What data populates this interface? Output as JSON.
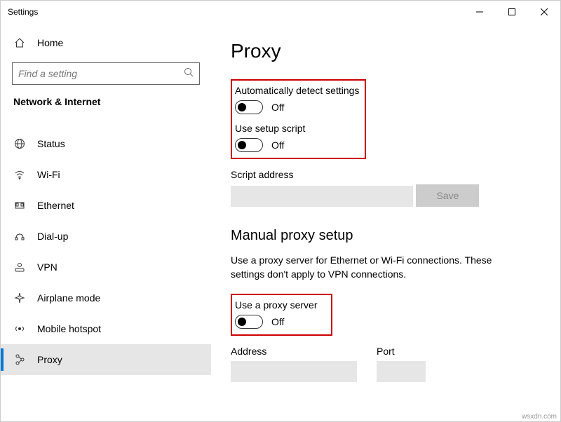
{
  "titlebar": {
    "title": "Settings"
  },
  "sidebar": {
    "home": "Home",
    "search_placeholder": "Find a setting",
    "section": "Network & Internet",
    "items": [
      {
        "label": "Status"
      },
      {
        "label": "Wi-Fi"
      },
      {
        "label": "Ethernet"
      },
      {
        "label": "Dial-up"
      },
      {
        "label": "VPN"
      },
      {
        "label": "Airplane mode"
      },
      {
        "label": "Mobile hotspot"
      },
      {
        "label": "Proxy"
      }
    ]
  },
  "main": {
    "title": "Proxy",
    "auto_detect": {
      "label": "Automatically detect settings",
      "state": "Off"
    },
    "setup_script": {
      "label": "Use setup script",
      "state": "Off"
    },
    "script_address_label": "Script address",
    "save": "Save",
    "manual_heading": "Manual proxy setup",
    "manual_desc": "Use a proxy server for Ethernet or Wi-Fi connections. These settings don't apply to VPN connections.",
    "use_proxy": {
      "label": "Use a proxy server",
      "state": "Off"
    },
    "address_label": "Address",
    "port_label": "Port"
  },
  "watermark": "wsxdn.com"
}
